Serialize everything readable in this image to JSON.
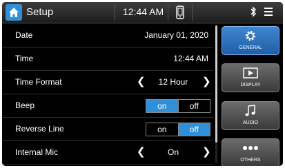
{
  "topbar": {
    "title": "Setup",
    "time": "12:44 AM"
  },
  "rows": [
    {
      "label": "Date",
      "value": "January 01, 2020"
    },
    {
      "label": "Time",
      "value": "12:44 AM"
    },
    {
      "label": "Time Format",
      "value": "12 Hour"
    },
    {
      "label": "Beep",
      "on": "on",
      "off": "off",
      "selected": "on"
    },
    {
      "label": "Reverse Line",
      "on": "on",
      "off": "off",
      "selected": "off"
    },
    {
      "label": "Internal Mic",
      "value": "On"
    }
  ],
  "side": [
    {
      "label": "GENERAL",
      "icon": "gear-icon",
      "active": true
    },
    {
      "label": "DISPLAY",
      "icon": "display-icon",
      "active": false
    },
    {
      "label": "AUDIO",
      "icon": "music-note-icon",
      "active": false
    },
    {
      "label": "OTHERS",
      "icon": "more-icon",
      "active": false
    }
  ],
  "colors": {
    "accent": "#2f8fd8"
  }
}
